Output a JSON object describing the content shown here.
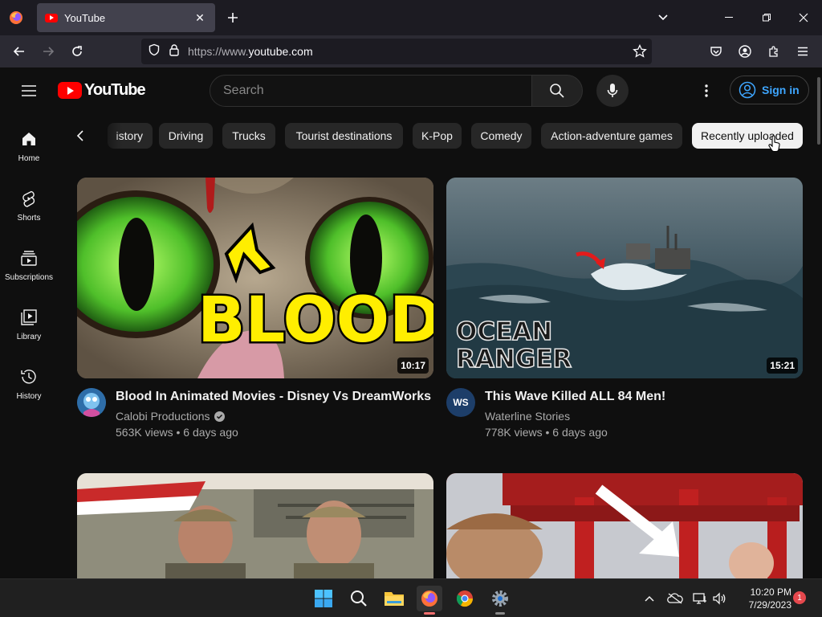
{
  "browser": {
    "tab_title": "YouTube",
    "url_prefix": "https://www.",
    "url_domain": "youtube.com"
  },
  "youtube": {
    "logo_text": "YouTube",
    "search_placeholder": "Search",
    "signin_label": "Sign in",
    "sidebar": [
      {
        "label": "Home",
        "icon": "home-icon"
      },
      {
        "label": "Shorts",
        "icon": "shorts-icon"
      },
      {
        "label": "Subscriptions",
        "icon": "subscriptions-icon"
      },
      {
        "label": "Library",
        "icon": "library-icon"
      },
      {
        "label": "History",
        "icon": "history-icon"
      }
    ],
    "chips": [
      "istory",
      "Driving",
      "Trucks",
      "Tourist destinations",
      "K-Pop",
      "Comedy",
      "Action-adventure games",
      "Recently uploaded"
    ],
    "videos": [
      {
        "title": "Blood In Animated Movies - Disney Vs DreamWorks",
        "channel": "Calobi Productions",
        "verified": true,
        "meta": "563K views • 6 days ago",
        "duration": "10:17",
        "thumb_text": "BLOOD"
      },
      {
        "title": "This Wave Killed ALL 84 Men!",
        "channel": "Waterline Stories",
        "verified": false,
        "avatar_text": "WS",
        "meta": "778K views • 6 days ago",
        "duration": "15:21",
        "thumb_text_1": "OCEAN",
        "thumb_text_2": "RANGER"
      }
    ]
  },
  "taskbar": {
    "time": "10:20 PM",
    "date": "7/29/2023",
    "notifications": "1"
  },
  "colors": {
    "yt_red": "#ff0000",
    "link_blue": "#3ea6ff",
    "bg": "#0f0f0f"
  }
}
